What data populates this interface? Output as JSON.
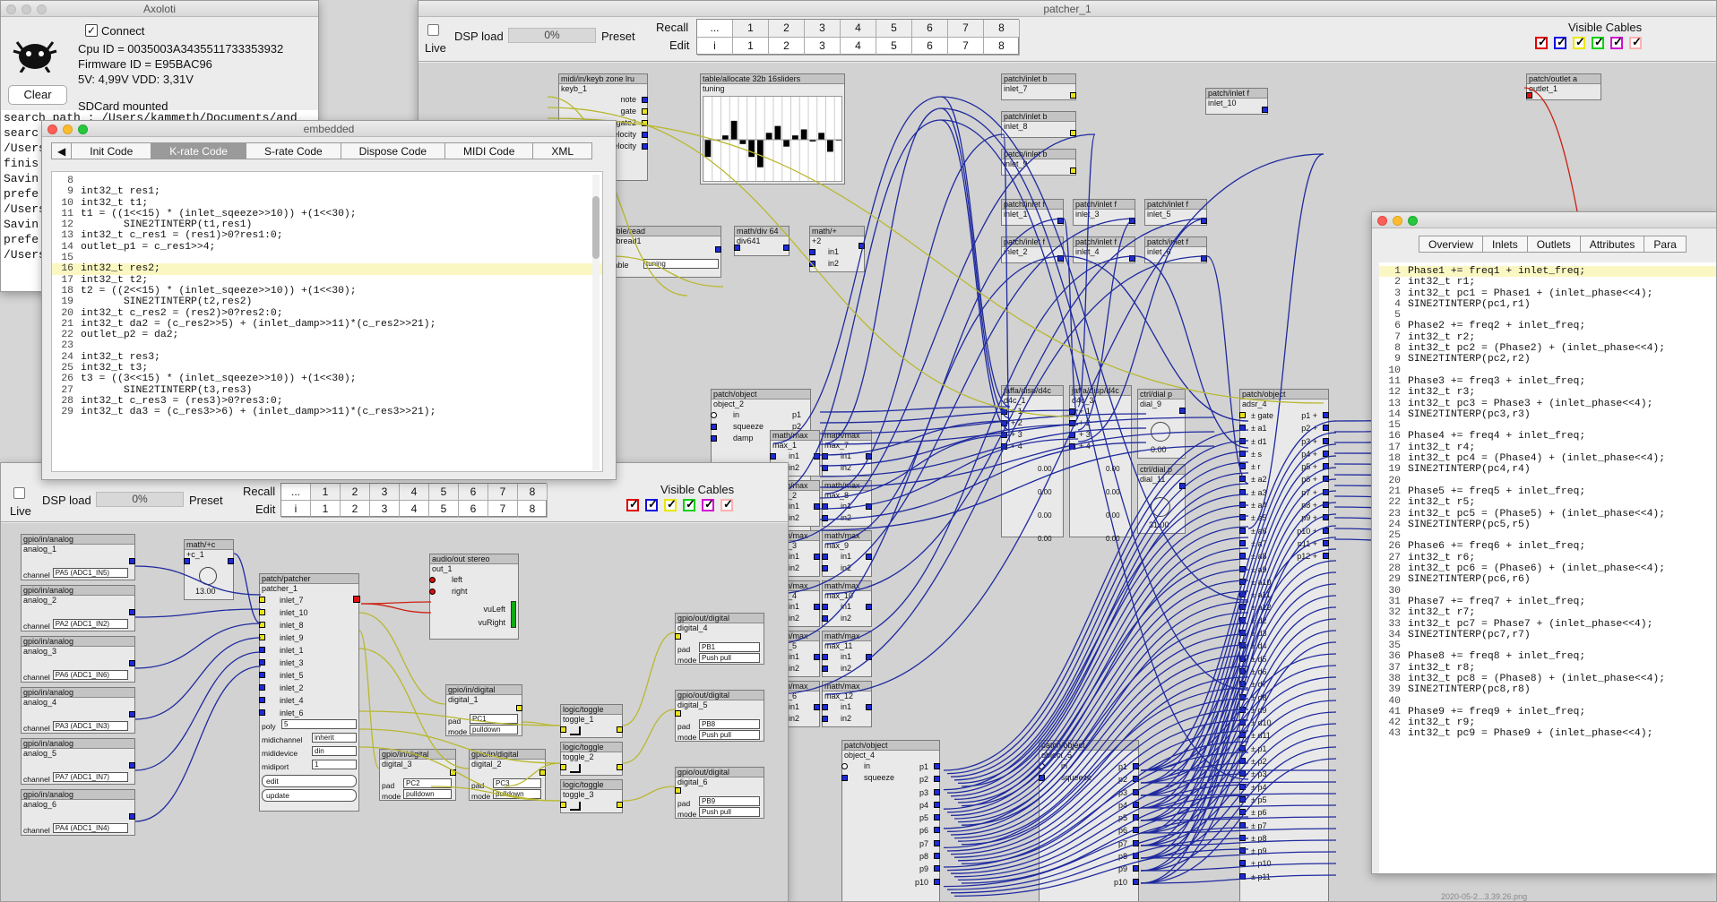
{
  "axoloti": {
    "title": "Axoloti",
    "connect_label": "Connect",
    "cpu_id": "Cpu ID = 0035003A3435511733353932",
    "firmware_id": "Firmware ID = E95BAC96",
    "voltage": "5V: 4,99V VDD: 3,31V",
    "clear_label": "Clear",
    "sdcard": "SDCard mounted",
    "log_lines": [
      "search path : /Users/kammeth/Documents/and",
      "searc",
      "/Users",
      "finis",
      "Savin",
      "prefe",
      "/Users",
      "Savin",
      "prefe",
      "/Users"
    ]
  },
  "patcher1": {
    "title": "patcher_1",
    "live_label": "Live",
    "dsp_label": "DSP load",
    "dsp_value": "0%",
    "preset_label": "Preset",
    "recall_label": "Recall",
    "edit_label": "Edit",
    "ellipsis": "...",
    "i_label": "i",
    "presets": [
      "1",
      "2",
      "3",
      "4",
      "5",
      "6",
      "7",
      "8"
    ],
    "visible_cables_label": "Visible Cables",
    "cable_colors": [
      "#e00000",
      "#1010e0",
      "#e8e800",
      "#10d010",
      "#d010d0",
      "#ffb0b0"
    ]
  },
  "embedded": {
    "title": "embedded",
    "tabs": [
      "Init Code",
      "K-rate Code",
      "S-rate Code",
      "Dispose Code",
      "MIDI Code",
      "XML"
    ],
    "active_tab": "K-rate Code",
    "code": [
      {
        "n": "8",
        "t": ""
      },
      {
        "n": "9",
        "t": "int32_t res1;"
      },
      {
        "n": "10",
        "t": "int32_t t1;"
      },
      {
        "n": "11",
        "t": "t1 = ((1<<15) * (inlet_sqeeze>>10)) +(1<<30);"
      },
      {
        "n": "12",
        "t": "       SINE2TINTERP(t1,res1)"
      },
      {
        "n": "13",
        "t": "int32_t c_res1 = (res1)>0?res1:0;"
      },
      {
        "n": "14",
        "t": "outlet_p1 = c_res1>>4;"
      },
      {
        "n": "15",
        "t": ""
      },
      {
        "n": "16",
        "t": "int32_t res2;"
      },
      {
        "n": "17",
        "t": "int32_t t2;"
      },
      {
        "n": "18",
        "t": "t2 = ((2<<15) * (inlet_sqeeze>>10)) +(1<<30);"
      },
      {
        "n": "19",
        "t": "       SINE2TINTERP(t2,res2)"
      },
      {
        "n": "20",
        "t": "int32_t c_res2 = (res2)>0?res2:0;"
      },
      {
        "n": "21",
        "t": "int32_t da2 = (c_res2>>5) + (inlet_damp>>11)*(c_res2>>21);"
      },
      {
        "n": "22",
        "t": "outlet_p2 = da2;"
      },
      {
        "n": "23",
        "t": ""
      },
      {
        "n": "24",
        "t": "int32_t res3;"
      },
      {
        "n": "25",
        "t": "int32_t t3;"
      },
      {
        "n": "26",
        "t": "t3 = ((3<<15) * (inlet_sqeeze>>10)) +(1<<30);"
      },
      {
        "n": "27",
        "t": "       SINE2TINTERP(t3,res3)"
      },
      {
        "n": "28",
        "t": "int32_t c_res3 = (res3)>0?res3:0;"
      },
      {
        "n": "29",
        "t": "int32_t da3 = (c_res3>>6) + (inlet_damp>>11)*(c_res3>>21);"
      }
    ]
  },
  "objwin": {
    "tabs": [
      "Overview",
      "Inlets",
      "Outlets",
      "Attributes",
      "Para"
    ],
    "code": [
      {
        "n": "1",
        "t": "Phase1 += freq1 + inlet_freq;"
      },
      {
        "n": "2",
        "t": "int32_t r1;"
      },
      {
        "n": "3",
        "t": "int32_t pc1 = Phase1 + (inlet_phase<<4);"
      },
      {
        "n": "4",
        "t": "SINE2TINTERP(pc1,r1)"
      },
      {
        "n": "5",
        "t": ""
      },
      {
        "n": "6",
        "t": "Phase2 += freq2 + inlet_freq;"
      },
      {
        "n": "7",
        "t": "int32_t r2;"
      },
      {
        "n": "8",
        "t": "int32_t pc2 = (Phase2) + (inlet_phase<<4);"
      },
      {
        "n": "9",
        "t": "SINE2TINTERP(pc2,r2)"
      },
      {
        "n": "10",
        "t": ""
      },
      {
        "n": "11",
        "t": "Phase3 += freq3 + inlet_freq;"
      },
      {
        "n": "12",
        "t": "int32_t r3;"
      },
      {
        "n": "13",
        "t": "int32_t pc3 = Phase3 + (inlet_phase<<4);"
      },
      {
        "n": "14",
        "t": "SINE2TINTERP(pc3,r3)"
      },
      {
        "n": "15",
        "t": ""
      },
      {
        "n": "16",
        "t": "Phase4 += freq4 + inlet_freq;"
      },
      {
        "n": "17",
        "t": "int32_t r4;"
      },
      {
        "n": "18",
        "t": "int32_t pc4 = (Phase4) + (inlet_phase<<4);"
      },
      {
        "n": "19",
        "t": "SINE2TINTERP(pc4,r4)"
      },
      {
        "n": "20",
        "t": ""
      },
      {
        "n": "21",
        "t": "Phase5 += freq5 + inlet_freq;"
      },
      {
        "n": "22",
        "t": "int32_t r5;"
      },
      {
        "n": "23",
        "t": "int32_t pc5 = (Phase5) + (inlet_phase<<4);"
      },
      {
        "n": "24",
        "t": "SINE2TINTERP(pc5,r5)"
      },
      {
        "n": "25",
        "t": ""
      },
      {
        "n": "26",
        "t": "Phase6 += freq6 + inlet_freq;"
      },
      {
        "n": "27",
        "t": "int32_t r6;"
      },
      {
        "n": "28",
        "t": "int32_t pc6 = (Phase6) + (inlet_phase<<4);"
      },
      {
        "n": "29",
        "t": "SINE2TINTERP(pc6,r6)"
      },
      {
        "n": "30",
        "t": ""
      },
      {
        "n": "31",
        "t": "Phase7 += freq7 + inlet_freq;"
      },
      {
        "n": "32",
        "t": "int32_t r7;"
      },
      {
        "n": "33",
        "t": "int32_t pc7 = Phase7 + (inlet_phase<<4);"
      },
      {
        "n": "34",
        "t": "SINE2TINTERP(pc7,r7)"
      },
      {
        "n": "35",
        "t": ""
      },
      {
        "n": "36",
        "t": "Phase8 += freq8 + inlet_freq;"
      },
      {
        "n": "37",
        "t": "int32_t r8;"
      },
      {
        "n": "38",
        "t": "int32_t pc8 = (Phase8) + (inlet_phase<<4);"
      },
      {
        "n": "39",
        "t": "SINE2TINTERP(pc8,r8)"
      },
      {
        "n": "40",
        "t": ""
      },
      {
        "n": "41",
        "t": "Phase9 += freq9 + inlet_freq;"
      },
      {
        "n": "42",
        "t": "int32_t r9;"
      },
      {
        "n": "43",
        "t": "int32_t pc9 = Phase9 + (inlet_phase<<4);"
      }
    ]
  },
  "subpatch": {
    "live_label": "Live",
    "dsp_label": "DSP load",
    "dsp_value": "0%",
    "preset_label": "Preset",
    "recall_label": "Recall",
    "edit_label": "Edit",
    "ellipsis": "...",
    "i_label": "i",
    "presets": [
      "1",
      "2",
      "3",
      "4",
      "5",
      "6",
      "7",
      "8"
    ],
    "visible_cables_label": "Visible Cables"
  },
  "objects": {
    "midi_in": {
      "type": "midi/in/keyb zone lru",
      "name": "keyb_1",
      "outs": [
        "note",
        "gate",
        "gate2",
        "velocity",
        "releaseVelocity"
      ]
    },
    "table_alloc": {
      "type": "table/allocate 32b 16sliders",
      "name": "tuning",
      "values": [
        0.3,
        0.5,
        0.55,
        0.72,
        0.45,
        0.3,
        0.18,
        0.58,
        0.66,
        0.42,
        0.55,
        0.62,
        0.48,
        0.58,
        0.36,
        0.5
      ]
    },
    "inlet7": {
      "type": "patch/inlet b",
      "name": "inlet_7"
    },
    "inlet8": {
      "type": "patch/inlet b",
      "name": "inlet_8"
    },
    "inlet9": {
      "type": "patch/inlet b",
      "name": "inlet_9"
    },
    "inlet10": {
      "type": "patch/inlet f",
      "name": "inlet_10"
    },
    "outlet1": {
      "type": "patch/outlet a",
      "name": "outlet_1"
    },
    "table_read": {
      "type": "table/read",
      "name": "tabread1",
      "table_label": "table",
      "table_value": "tuning"
    },
    "mathdiv": {
      "type": "math/div 64",
      "name": "div641"
    },
    "mathplus": {
      "type": "math/+",
      "name": "+2",
      "ins": [
        "in1",
        "in2"
      ]
    },
    "inletf": [
      {
        "type": "patch/inlet f",
        "name": "inlet_1"
      },
      {
        "type": "patch/inlet f",
        "name": "inlet_3"
      },
      {
        "type": "patch/inlet f",
        "name": "inlet_5"
      },
      {
        "type": "patch/inlet f",
        "name": "inlet_2"
      },
      {
        "type": "patch/inlet f",
        "name": "inlet_4"
      },
      {
        "type": "patch/inlet f",
        "name": "inlet_6"
      }
    ],
    "obj2": {
      "type": "patch/object",
      "name": "object_2",
      "ins": [
        "in",
        "squeeze",
        "damp"
      ],
      "outs": [
        "p1",
        "p2",
        "p3",
        "p4"
      ]
    },
    "maxes": [
      {
        "type": "math/max",
        "name": "max_1"
      },
      {
        "type": "math/max",
        "name": "max_7"
      },
      {
        "type": "math/max",
        "name": "max_2"
      },
      {
        "type": "math/max",
        "name": "max_8"
      },
      {
        "type": "math/max",
        "name": "max_3"
      },
      {
        "type": "math/max",
        "name": "max_9"
      },
      {
        "type": "math/max",
        "name": "max_4"
      },
      {
        "type": "math/max",
        "name": "max_10"
      },
      {
        "type": "math/max",
        "name": "max_5"
      },
      {
        "type": "math/max",
        "name": "max_11"
      },
      {
        "type": "math/max",
        "name": "max_6"
      },
      {
        "type": "math/max",
        "name": "max_12"
      }
    ],
    "max_ins": [
      "in1",
      "in2"
    ],
    "d4c1": {
      "type": "jaffa/disp/d4c",
      "name": "d4c_1",
      "ins": [
        "1",
        "2",
        "3",
        "4"
      ],
      "vals": [
        "0.00",
        "0.00",
        "0.00",
        "0.00"
      ]
    },
    "d4c3": {
      "type": "jaffa/disp/d4c",
      "name": "d4c_3",
      "ins": [
        "1",
        "2",
        "3",
        "4"
      ],
      "vals": [
        "0.00",
        "0.00",
        "0.00",
        "0.00"
      ]
    },
    "dial9": {
      "type": "ctrl/dial p",
      "name": "dial_9",
      "value": "0.00"
    },
    "dial11": {
      "type": "ctrl/dial p",
      "name": "dial_11",
      "value": "31.00"
    },
    "adsr": {
      "type": "patch/object",
      "name": "adsr_4",
      "ins": [
        "gate",
        "a1",
        "d1",
        "s",
        "r",
        "a2",
        "a3",
        "a4",
        "a5",
        "a6",
        "a7",
        "a8",
        "a9",
        "a10",
        "a11",
        "a12",
        "d2",
        "d3",
        "d4",
        "d5",
        "d6",
        "d7",
        "d8",
        "d9",
        "d10",
        "d11",
        "p1",
        "p2",
        "p3",
        "p4",
        "p5",
        "p6",
        "p7",
        "p8",
        "p9",
        "p10",
        "p11"
      ],
      "outs": [
        "p1",
        "p2",
        "p3",
        "p4",
        "p5",
        "p6",
        "p7",
        "p8",
        "p9",
        "p10",
        "p11",
        "p12"
      ]
    },
    "obj4": {
      "type": "patch/object",
      "name": "object_4",
      "ins": [
        "in",
        "squeeze"
      ],
      "outs": [
        "p1",
        "p2",
        "p3",
        "p4",
        "p5",
        "p6",
        "p7",
        "p8",
        "p9",
        "p10"
      ]
    },
    "obj5": {
      "type": "patch/object",
      "name": "object_5",
      "ins": [
        "in",
        "squeeze"
      ],
      "outs": [
        "p1",
        "p2",
        "p3",
        "p4",
        "p5",
        "p6",
        "p7",
        "p8",
        "p9",
        "p10"
      ]
    },
    "analogs": [
      {
        "type": "gpio/in/analog",
        "name": "analog_1",
        "channel": "PA5 (ADC1_IN5)"
      },
      {
        "type": "gpio/in/analog",
        "name": "analog_2",
        "channel": "PA2 (ADC1_IN2)"
      },
      {
        "type": "gpio/in/analog",
        "name": "analog_3",
        "channel": "PA6 (ADC1_IN6)"
      },
      {
        "type": "gpio/in/analog",
        "name": "analog_4",
        "channel": "PA3 (ADC1_IN3)"
      },
      {
        "type": "gpio/in/analog",
        "name": "analog_5",
        "channel": "PA7 (ADC1_IN7)"
      },
      {
        "type": "gpio/in/analog",
        "name": "analog_6",
        "channel": "PA4 (ADC1_IN4)"
      }
    ],
    "channel_label": "channel",
    "mathc": {
      "type": "math/+c",
      "name": "+c_1",
      "value": "13.00"
    },
    "patcher": {
      "type": "patch/patcher",
      "name": "patcher_1",
      "ins": [
        "inlet_7",
        "inlet_10",
        "inlet_8",
        "inlet_9",
        "inlet_1",
        "inlet_3",
        "inlet_5",
        "inlet_2",
        "inlet_4",
        "inlet_6"
      ],
      "poly_label": "poly",
      "poly": "5",
      "midichannel_label": "midichannel",
      "midichannel": "inherit",
      "mididevice_label": "mididevice",
      "mididevice": "din",
      "midiport_label": "midiport",
      "midiport": "1",
      "edit_label": "edit",
      "update_label": "update"
    },
    "audioout": {
      "type": "audio/out stereo",
      "name": "out_1",
      "ins": [
        "left",
        "right"
      ],
      "vu": [
        "vuLeft",
        "vuRight"
      ]
    },
    "dig_in": [
      {
        "type": "gpio/in/digital",
        "name": "digital_1",
        "pad": "PC1",
        "mode": "pulldown"
      },
      {
        "type": "gpio/in/digital",
        "name": "digital_3",
        "pad": "PC2",
        "mode": "pulldown"
      },
      {
        "type": "gpio/in/digital",
        "name": "digital_2",
        "pad": "PC3",
        "mode": "pulldown"
      }
    ],
    "pad_label": "pad",
    "mode_label": "mode",
    "toggles": [
      {
        "type": "logic/toggle",
        "name": "toggle_1"
      },
      {
        "type": "logic/toggle",
        "name": "toggle_2"
      },
      {
        "type": "logic/toggle",
        "name": "toggle_3"
      }
    ],
    "dig_out": [
      {
        "type": "gpio/out/digital",
        "name": "digital_4",
        "pad": "PB1",
        "mode": "Push pull"
      },
      {
        "type": "gpio/out/digital",
        "name": "digital_5",
        "pad": "PB8",
        "mode": "Push pull"
      },
      {
        "type": "gpio/out/digital",
        "name": "digital_6",
        "pad": "PB9",
        "mode": "Push pull"
      }
    ]
  },
  "footer": {
    "screenshot_name": "2020-05-2...3.39.26.png"
  }
}
